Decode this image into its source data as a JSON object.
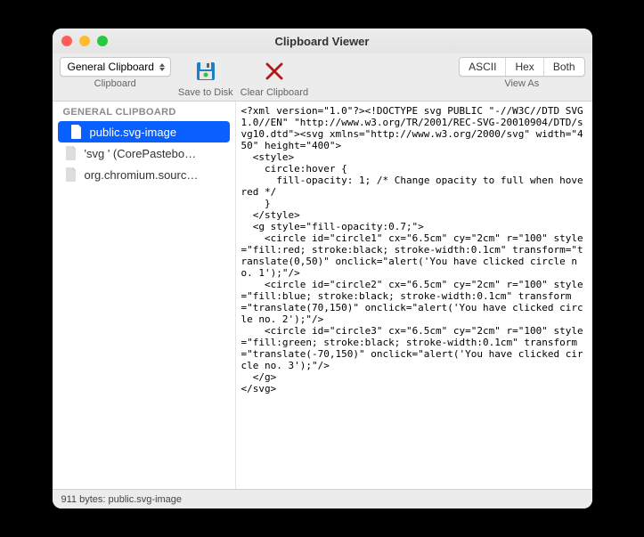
{
  "window": {
    "title": "Clipboard Viewer"
  },
  "toolbar": {
    "clipboard_select": "General Clipboard",
    "clipboard_label": "Clipboard",
    "save_label": "Save to Disk",
    "clear_label": "Clear Clipboard",
    "view_as_label": "View As",
    "segments": {
      "ascii": "ASCII",
      "hex": "Hex",
      "both": "Both"
    }
  },
  "sidebar": {
    "header": "GENERAL CLIPBOARD",
    "items": [
      {
        "label": "public.svg-image",
        "selected": true
      },
      {
        "label": "'svg ' (CorePastebo…",
        "selected": false
      },
      {
        "label": "org.chromium.sourc…",
        "selected": false
      }
    ]
  },
  "content": "<?xml version=\"1.0\"?><!DOCTYPE svg PUBLIC \"-//W3C//DTD SVG 1.0//EN\" \"http://www.w3.org/TR/2001/REC-SVG-20010904/DTD/svg10.dtd\"><svg xmlns=\"http://www.w3.org/2000/svg\" width=\"450\" height=\"400\">\n  <style>\n    circle:hover {\n      fill-opacity: 1; /* Change opacity to full when hovered */\n    }\n  </style>\n  <g style=\"fill-opacity:0.7;\">\n    <circle id=\"circle1\" cx=\"6.5cm\" cy=\"2cm\" r=\"100\" style=\"fill:red; stroke:black; stroke-width:0.1cm\" transform=\"translate(0,50)\" onclick=\"alert('You have clicked circle no. 1');\"/>\n    <circle id=\"circle2\" cx=\"6.5cm\" cy=\"2cm\" r=\"100\" style=\"fill:blue; stroke:black; stroke-width:0.1cm\" transform=\"translate(70,150)\" onclick=\"alert('You have clicked circle no. 2');\"/>\n    <circle id=\"circle3\" cx=\"6.5cm\" cy=\"2cm\" r=\"100\" style=\"fill:green; stroke:black; stroke-width:0.1cm\" transform=\"translate(-70,150)\" onclick=\"alert('You have clicked circle no. 3');\"/>\n  </g>\n</svg>",
  "statusbar": {
    "text": "911 bytes: public.svg-image"
  }
}
